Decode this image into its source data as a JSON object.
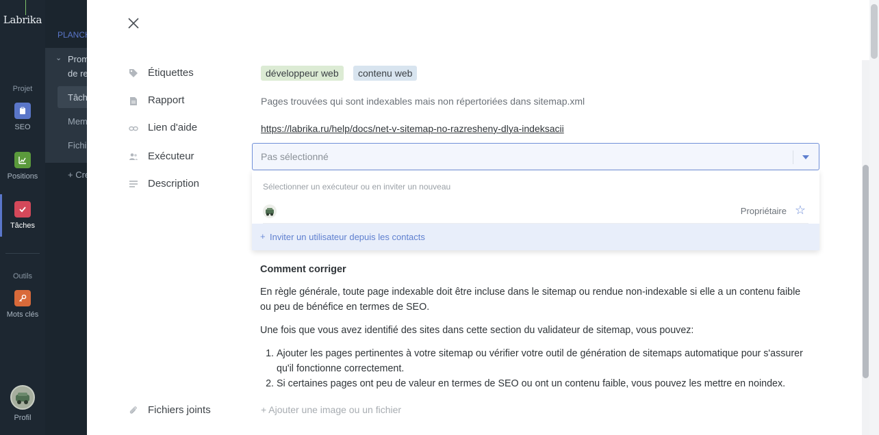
{
  "rail": {
    "logo": "Labrika",
    "section_project": "Projet",
    "section_tools": "Outils",
    "items": [
      {
        "label": "SEO",
        "icon": "clipboard-icon",
        "color": "#5a76c9"
      },
      {
        "label": "Positions",
        "icon": "chart-icon",
        "color": "#5b9a3c"
      },
      {
        "label": "Tâches",
        "icon": "check-icon",
        "color": "#d4485a"
      },
      {
        "label": "Mots clés",
        "icon": "key-icon",
        "color": "#d96a3a"
      }
    ],
    "profile_label": "Profil"
  },
  "sidebar": {
    "heading": "PLANCH",
    "group_line1": "Prom",
    "group_line2": "de re",
    "items": [
      "Tâch",
      "Mem",
      "Fichi"
    ],
    "create": "+ Cre"
  },
  "modal": {
    "fields": {
      "tags_label": "Étiquettes",
      "tags": [
        "développeur web",
        "contenu web"
      ],
      "report_label": "Rapport",
      "report_value": "Pages trouvées qui sont indexables mais non répertoriées dans sitemap.xml",
      "help_label": "Lien d'aide",
      "help_link": "https://labrika.ru/help/docs/net-v-sitemap-no-razresheny-dlya-indeksacii",
      "executor_label": "Exécuteur",
      "executor_placeholder": "Pas sélectionné",
      "description_label": "Description",
      "attachments_label": "Fichiers joints",
      "add_file": "+ Ajouter une image ou un fichier"
    },
    "dropdown": {
      "hint": "Sélectionner un exécuteur ou en inviter un nouveau",
      "user_role": "Propriétaire",
      "invite_plus": "+",
      "invite_text": "Inviter un utilisateur depuis les contacts"
    },
    "description": {
      "heading": "Comment corriger",
      "p1": "En règle générale, toute page indexable doit être incluse dans le sitemap ou rendue non-indexable si elle a un contenu faible ou peu de bénéfice en termes de SEO.",
      "p2": "Une fois que vous avez identifié des sites dans cette section du validateur de sitemap, vous pouvez:",
      "list": [
        "Ajouter les pages pertinentes à votre sitemap ou vérifier votre outil de génération de sitemaps automatique pour s'assurer qu'il fonctionne correctement.",
        "Si certaines pages ont peu de valeur en termes de SEO ou ont un contenu faible, vous pouvez les mettre en noindex."
      ]
    }
  }
}
